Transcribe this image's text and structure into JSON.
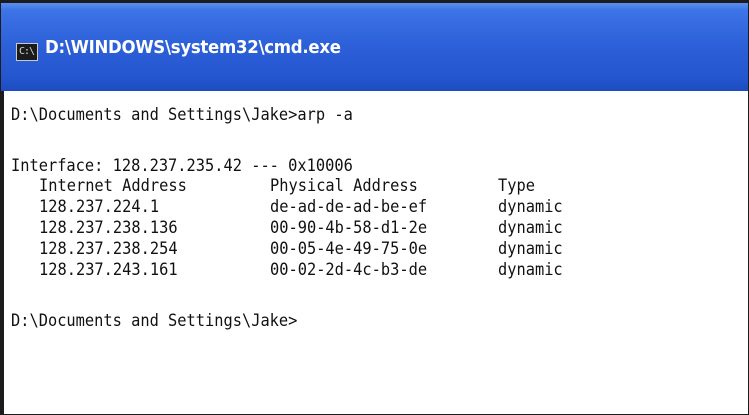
{
  "window": {
    "title": "D:\\WINDOWS\\system32\\cmd.exe",
    "icon": "cmd-icon",
    "icon_glyph": "C:\\"
  },
  "console": {
    "line1": "D:\\Documents and Settings\\Jake>arp -a",
    "interface_line": "Interface: 128.237.235.42 --- 0x10006",
    "headers": [
      "Internet Address",
      "Physical Address",
      "Type"
    ],
    "rows": [
      [
        "128.237.224.1",
        "de-ad-de-ad-be-ef",
        "dynamic"
      ],
      [
        "128.237.238.136",
        "00-90-4b-58-d1-2e",
        "dynamic"
      ],
      [
        "128.237.238.254",
        "00-05-4e-49-75-0e",
        "dynamic"
      ],
      [
        "128.237.243.161",
        "00-02-2d-4c-b3-de",
        "dynamic"
      ]
    ],
    "prompt": "D:\\Documents and Settings\\Jake>"
  },
  "colors": {
    "titlebar": "#2c5fd8",
    "title_text": "#ffffff",
    "console_bg": "#ffffff",
    "console_text": "#111111"
  }
}
